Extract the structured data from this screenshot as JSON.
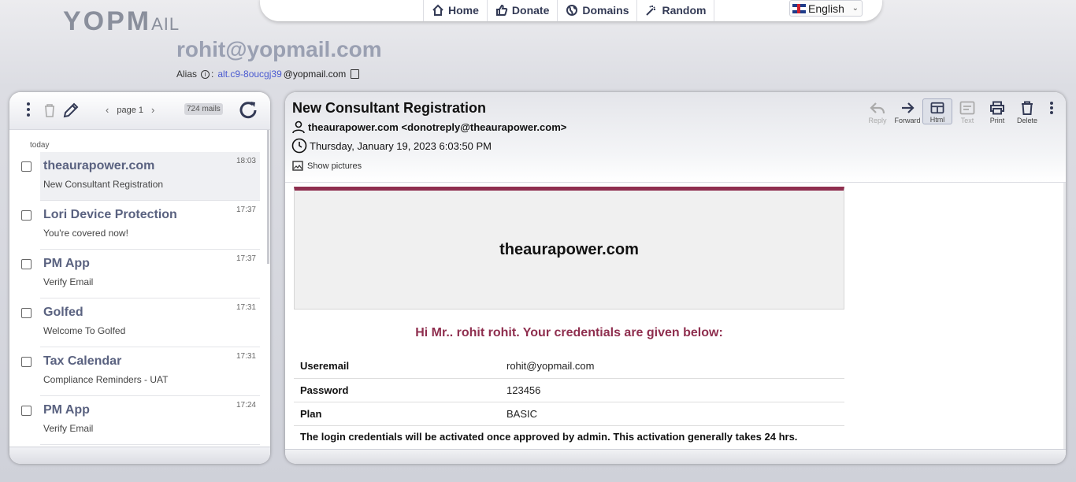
{
  "logo": {
    "text_main": "YOPM",
    "text_tail": "AIL"
  },
  "nav": {
    "items": [
      {
        "label": "Home",
        "icon": "home-icon"
      },
      {
        "label": "Donate",
        "icon": "thumbs-up-icon"
      },
      {
        "label": "Domains",
        "icon": "globe-icon"
      },
      {
        "label": "Random",
        "icon": "magic-wand-icon"
      }
    ],
    "language": "English"
  },
  "mailbox": {
    "address": "rohit@yopmail.com",
    "alias_label": "Alias",
    "alias_sep": ":",
    "alias_id": "alt.c9-8oucgj39",
    "alias_domain": "@yopmail.com"
  },
  "inbox": {
    "page_label": "page 1",
    "mail_count": "724 mails",
    "group_label": "today",
    "mails": [
      {
        "from": "theaurapower.com",
        "subject": "New Consultant Registration",
        "time": "18:03"
      },
      {
        "from": "Lori Device Protection",
        "subject": "You're covered now!",
        "time": "17:37"
      },
      {
        "from": "PM App",
        "subject": "Verify Email",
        "time": "17:37"
      },
      {
        "from": "Golfed",
        "subject": "Welcome To Golfed",
        "time": "17:31"
      },
      {
        "from": "Tax Calendar",
        "subject": "Compliance Reminders - UAT",
        "time": "17:31"
      },
      {
        "from": "PM App",
        "subject": "Verify Email",
        "time": "17:24"
      }
    ]
  },
  "message": {
    "subject": "New Consultant Registration",
    "sender": "theaurapower.com <donotreply@theaurapower.com>",
    "date": "Thursday, January 19, 2023 6:03:50 PM",
    "show_pictures": "Show pictures",
    "actions": {
      "reply": "Reply",
      "forward": "Forward",
      "html": "Html",
      "text": "Text",
      "print": "Print",
      "delete": "Delete"
    },
    "content": {
      "banner": "theaurapower.com",
      "greeting": "Hi Mr.. rohit rohit. Your credentials are given below:",
      "rows": [
        {
          "key": "Useremail",
          "value": "rohit@yopmail.com"
        },
        {
          "key": "Password",
          "value": "123456"
        },
        {
          "key": "Plan",
          "value": "BASIC"
        }
      ],
      "note": "The login credentials will be activated once approved by admin. This activation generally takes 24 hrs."
    }
  },
  "colors": {
    "accent": "#8f2f4f",
    "nav_text": "#333a55",
    "sender_text": "#5a6280"
  }
}
